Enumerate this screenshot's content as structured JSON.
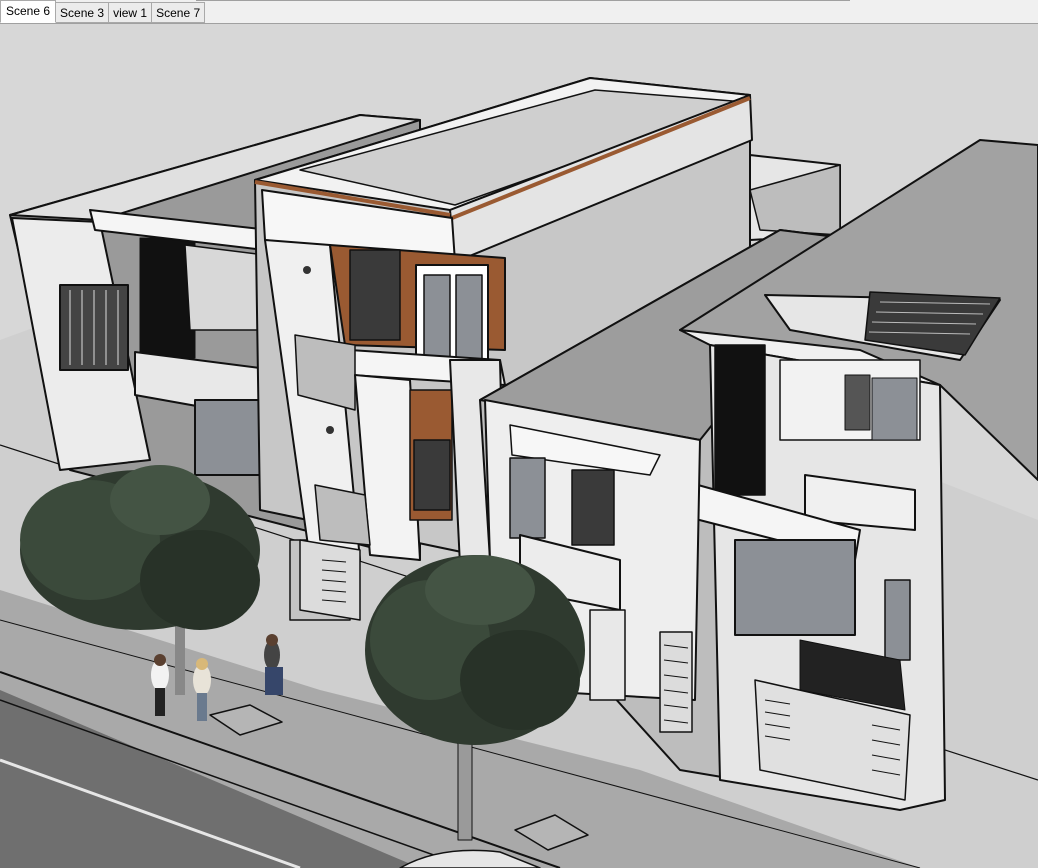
{
  "scenes": {
    "tabs": [
      {
        "label": "Scene 6",
        "active": true
      },
      {
        "label": "Scene 3",
        "active": false
      },
      {
        "label": "view 1",
        "active": false
      },
      {
        "label": "Scene 7",
        "active": false
      }
    ]
  },
  "colors": {
    "sky": "#d7d7d7",
    "ground": "#cfcfcf",
    "road": "#6f6f6f",
    "wall_light": "#ececec",
    "wall_mid": "#c4c4c4",
    "wall_dark": "#9a9a9a",
    "wood": "#9a5a32",
    "glass": "#8c9096",
    "tree": "#2f3a2f"
  }
}
